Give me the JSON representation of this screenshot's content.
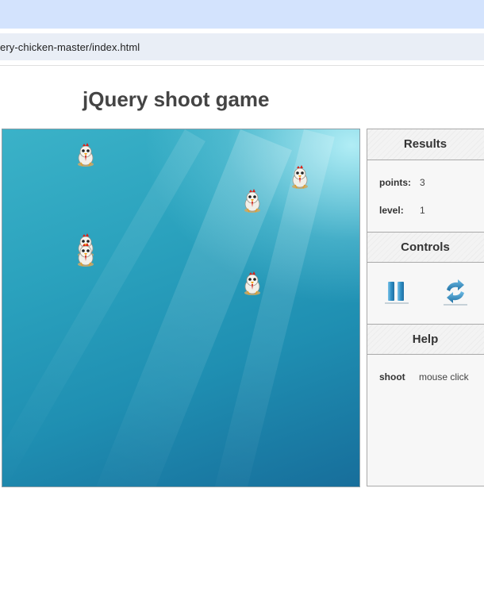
{
  "browser": {
    "url": "ery-chicken-master/index.html"
  },
  "page": {
    "title": "jQuery shoot game"
  },
  "game": {
    "chickens": 5
  },
  "results": {
    "heading": "Results",
    "points_label": "points:",
    "points_value": "3",
    "level_label": "level:",
    "level_value": "1"
  },
  "controls": {
    "heading": "Controls",
    "pause_icon": "pause-icon",
    "restart_icon": "refresh-icon"
  },
  "help": {
    "heading": "Help",
    "action_label": "shoot",
    "action_value": "mouse click"
  },
  "colors": {
    "accent_blue": "#2f8fc4",
    "playfield_top": "#3bb2c8",
    "playfield_bottom": "#176e9b"
  }
}
